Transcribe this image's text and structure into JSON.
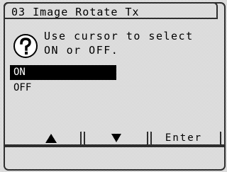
{
  "dialog": {
    "title": "03 Image Rotate Tx"
  },
  "prompt": {
    "icon": "question-mark-icon",
    "line1": "Use cursor to select",
    "line2": "ON or OFF."
  },
  "options": [
    {
      "label": "ON",
      "selected": true
    },
    {
      "label": "OFF",
      "selected": false
    }
  ],
  "softkeys": {
    "up_icon": "up-arrow-icon",
    "down_icon": "down-arrow-icon",
    "enter_label": "Enter"
  },
  "colors": {
    "selected_background": "#000000",
    "selected_text": "#ffffff",
    "text": "#000000"
  }
}
